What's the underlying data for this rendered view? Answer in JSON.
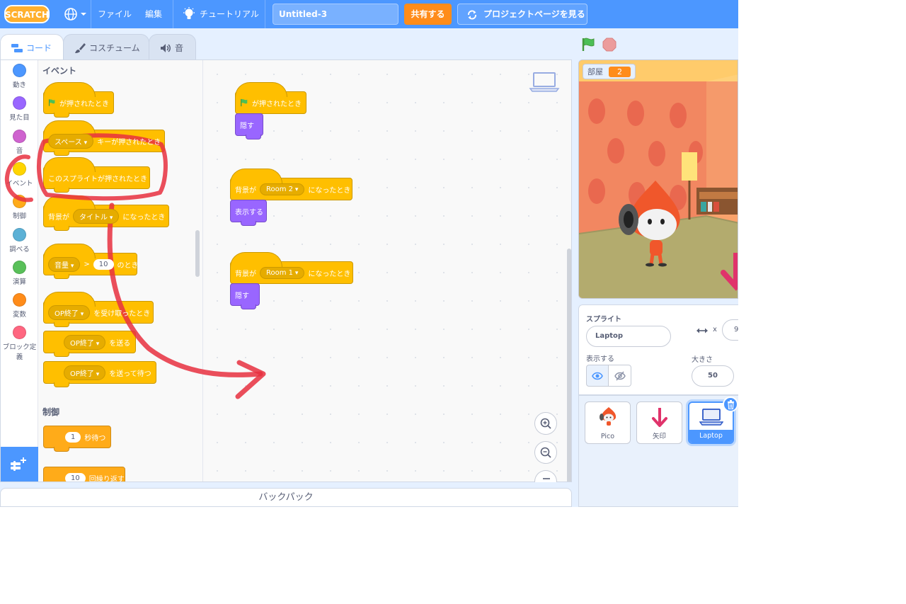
{
  "menubar": {
    "logo": "SCRATCH",
    "file": "ファイル",
    "edit": "編集",
    "tutorials": "チュートリアル",
    "project_title": "Untitled-3",
    "share": "共有する",
    "project_page": "プロジェクトページを見る"
  },
  "tabs": [
    {
      "label": "コード",
      "active": true
    },
    {
      "label": "コスチューム",
      "active": false
    },
    {
      "label": "音",
      "active": false
    }
  ],
  "categories": [
    {
      "label": "動き",
      "color": "#4c97ff"
    },
    {
      "label": "見た目",
      "color": "#9966ff"
    },
    {
      "label": "音",
      "color": "#cf63cf"
    },
    {
      "label": "イベント",
      "color": "#ffd500"
    },
    {
      "label": "制御",
      "color": "#ffab19"
    },
    {
      "label": "調べる",
      "color": "#5cb1d6"
    },
    {
      "label": "演算",
      "color": "#59c059"
    },
    {
      "label": "変数",
      "color": "#ff8c1a"
    },
    {
      "label": "ブロック定義",
      "color": "#ff6680"
    }
  ],
  "palette": {
    "events_heading": "イベント",
    "control_heading": "制御",
    "flag_clicked": "が押されたとき",
    "key_pressed_pre": "スペース",
    "key_pressed_post": "キーが押されたとき",
    "sprite_clicked": "このスプライトが押されたとき",
    "backdrop_pre": "背景が",
    "backdrop_value": "タイトル",
    "backdrop_post": "になったとき",
    "loudness_option": "音量",
    "gt": ">",
    "loudness_value": "10",
    "loudness_post": "のとき",
    "receive_value": "OP終了",
    "receive_post": "を受け取ったとき",
    "broadcast_value": "OP終了",
    "broadcast_post": "を送る",
    "broadcast_wait_value": "OP終了",
    "broadcast_wait_post": "を送って待つ",
    "wait_value": "1",
    "wait_post": "秒待つ",
    "repeat_value": "10",
    "repeat_post": "回繰り返す"
  },
  "scripts": {
    "s1_hat": "が押されたとき",
    "s1_action": "隠す",
    "s2_pre": "背景が",
    "s2_value": "Room 2",
    "s2_post": "になったとき",
    "s2_action": "表示する",
    "s3_pre": "背景が",
    "s3_value": "Room 1",
    "s3_post": "になったとき",
    "s3_action": "隠す"
  },
  "backpack": "バックパック",
  "stage": {
    "monitor_label": "部屋",
    "monitor_value": "2"
  },
  "sprite_info": {
    "sprite_label": "スプライト",
    "sprite_name": "Laptop",
    "x_label": "x",
    "x_value": "9",
    "show_label": "表示する",
    "size_label": "大きさ",
    "size_value": "50"
  },
  "sprites": [
    {
      "name": "Pico",
      "selected": false
    },
    {
      "name": "矢印",
      "selected": false
    },
    {
      "name": "Laptop",
      "selected": true
    }
  ],
  "colors": {
    "menubar": "#4c97ff",
    "events": "#ffbf00",
    "looks": "#9966ff",
    "control": "#ffab19",
    "share": "#ff8c1a",
    "annotation": "#e8303f"
  }
}
